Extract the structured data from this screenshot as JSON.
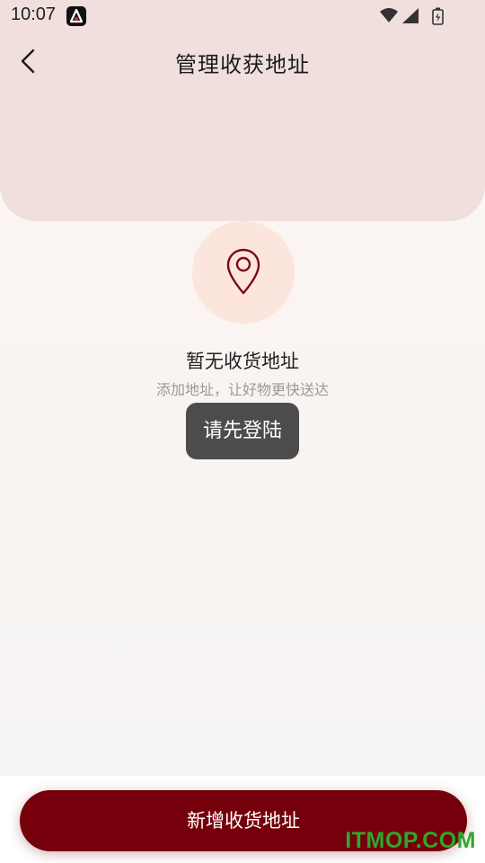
{
  "status_bar": {
    "time": "10:07",
    "icons": [
      "app-badge-icon",
      "wifi-icon",
      "signal-icon",
      "battery-charging-icon"
    ]
  },
  "header": {
    "title": "管理收获地址",
    "back_icon": "chevron-left-icon"
  },
  "empty_state": {
    "icon": "location-pin-icon",
    "title": "暂无收货地址",
    "subtitle": "添加地址，让好物更快送达"
  },
  "toast": {
    "text": "请先登陆"
  },
  "footer": {
    "add_button_label": "新增收货地址"
  },
  "watermark": "ITMOP.COM",
  "colors": {
    "header_bg": "#f0dfdd",
    "accent": "#75000b",
    "pin_circle": "#fce5dc",
    "toast_bg": "#4c4c4c",
    "watermark": "#2fa82a"
  }
}
